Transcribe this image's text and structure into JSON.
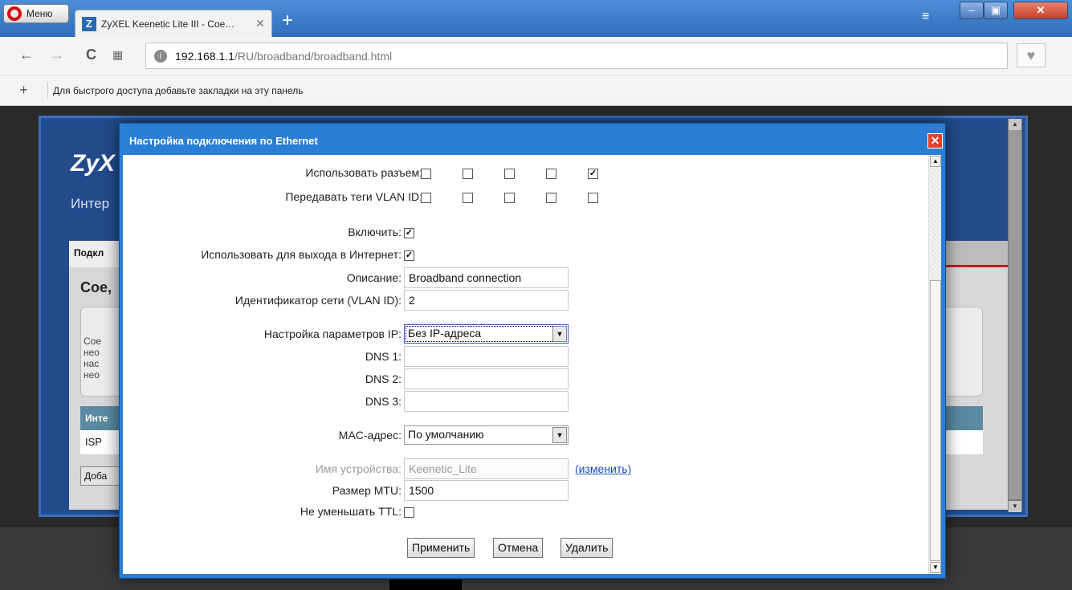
{
  "browser": {
    "menu_label": "Меню",
    "tab_title": "ZyXEL Keenetic Lite III - Сое…",
    "tab_favicon": "Z",
    "url_host": "192.168.1.1",
    "url_path": "/RU/broadband/broadband.html",
    "bookmarks_hint": "Для быстрого доступа добавьте закладки на эту панель",
    "icons": [
      "opera-logo-icon",
      "new-tab-icon",
      "tab-menu-icon",
      "minimize-icon",
      "maximize-icon",
      "close-icon",
      "back-icon",
      "forward-icon",
      "reload-icon",
      "speed-dial-icon",
      "globe-icon",
      "heart-icon",
      "add-bookmark-icon"
    ]
  },
  "background_page": {
    "logo": "ZyX",
    "subtitle": "Интер",
    "active_tab": "Подкл",
    "section_title": "Сое,",
    "info_text": "Сое\nнео\nнас\nнео",
    "table_header": "Инте",
    "table_row": "ISP",
    "add_button": "Доба"
  },
  "dialog": {
    "title": "Настройка подключения по Ethernet",
    "ports": {
      "use_port_label": "Использовать разъем:",
      "use_port_checked": [
        false,
        false,
        false,
        false,
        true
      ],
      "vlan_tag_label": "Передавать теги VLAN ID:",
      "vlan_tag_checked": [
        false,
        false,
        false,
        false,
        false
      ]
    },
    "enable_label": "Включить:",
    "enable_checked": true,
    "internet_label": "Использовать для выхода в Интернет:",
    "internet_checked": true,
    "description_label": "Описание:",
    "description_value": "Broadband connection",
    "vlan_id_label": "Идентификатор сети (VLAN ID):",
    "vlan_id_value": "2",
    "ip_settings_label": "Настройка параметров IP:",
    "ip_settings_value": "Без IP-адреса",
    "dns1_label": "DNS 1:",
    "dns1_value": "",
    "dns2_label": "DNS 2:",
    "dns2_value": "",
    "dns3_label": "DNS 3:",
    "dns3_value": "",
    "mac_label": "MAC-адрес:",
    "mac_value": "По умолчанию",
    "device_name_label": "Имя устройства:",
    "device_name_value": "Keenetic_Lite",
    "change_link": "(изменить)",
    "mtu_label": "Размер MTU:",
    "mtu_value": "1500",
    "ttl_label": "Не уменьшать TTL:",
    "ttl_checked": false,
    "buttons": {
      "apply": "Применить",
      "cancel": "Отмена",
      "delete": "Удалить"
    }
  }
}
